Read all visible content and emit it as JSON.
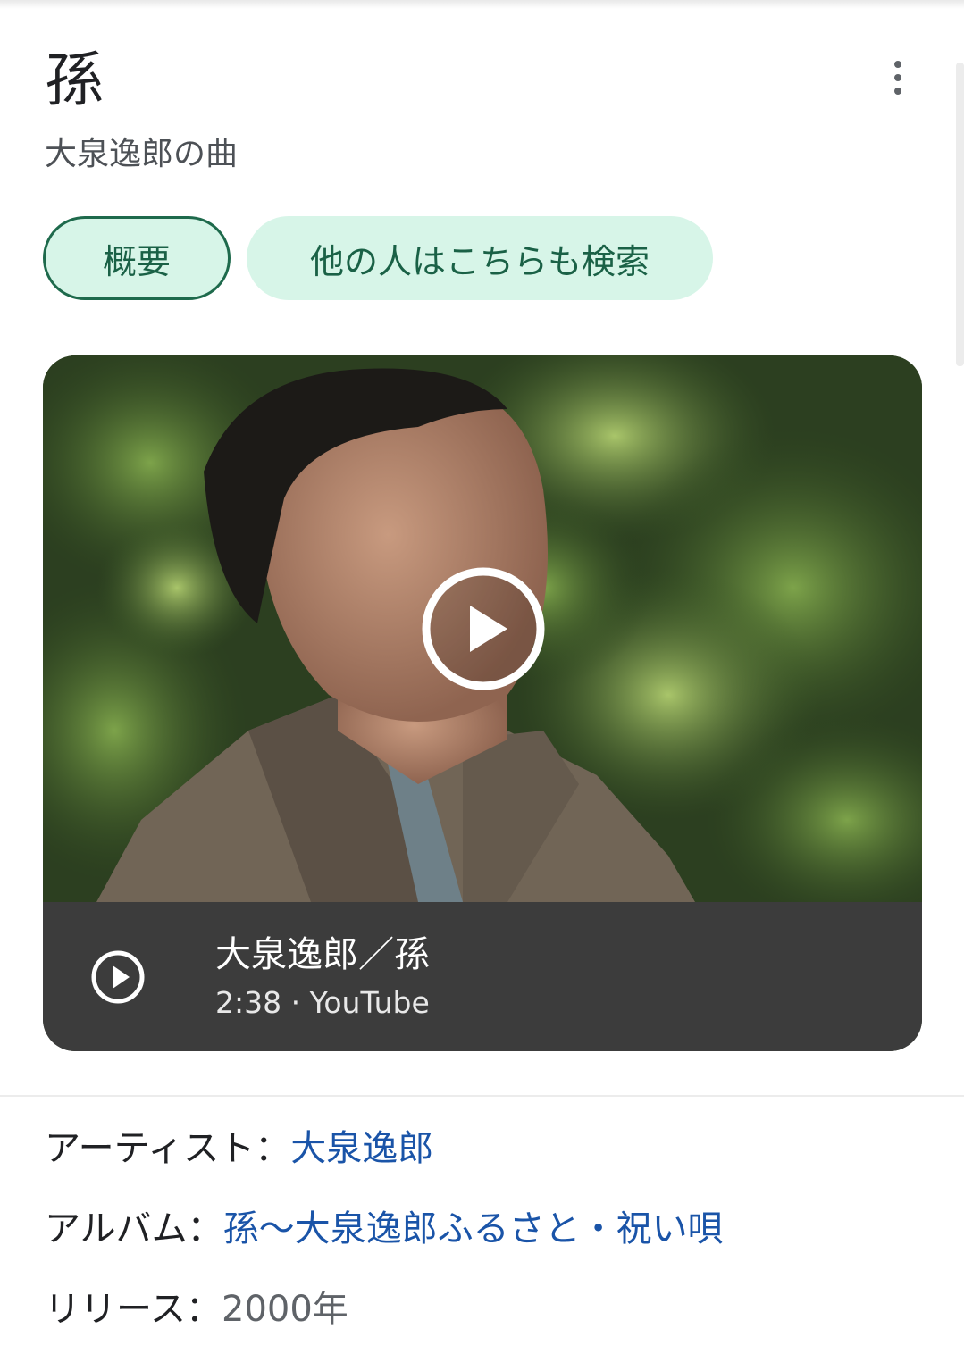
{
  "header": {
    "title": "孫",
    "subtitle": "大泉逸郎の曲"
  },
  "tabs": [
    {
      "label": "概要",
      "selected": true
    },
    {
      "label": "他の人はこちらも検索",
      "selected": false
    }
  ],
  "video": {
    "title": "大泉逸郎／孫",
    "meta": "2:38 · YouTube"
  },
  "details": {
    "artist_label": "アーティスト：",
    "artist_value": "大泉逸郎",
    "album_label": "アルバム：",
    "album_value": "孫〜大泉逸郎ふるさと・祝い唄",
    "release_label": "リリース：",
    "release_value": "2000年"
  },
  "icons": [
    "more-vert-icon",
    "play-icon",
    "play-circle-icon"
  ],
  "colors": {
    "chip_bg": "#d7f5e8",
    "chip_text": "#1a6146",
    "link": "#1a54a8",
    "video_bar": "#3c3c3c"
  }
}
